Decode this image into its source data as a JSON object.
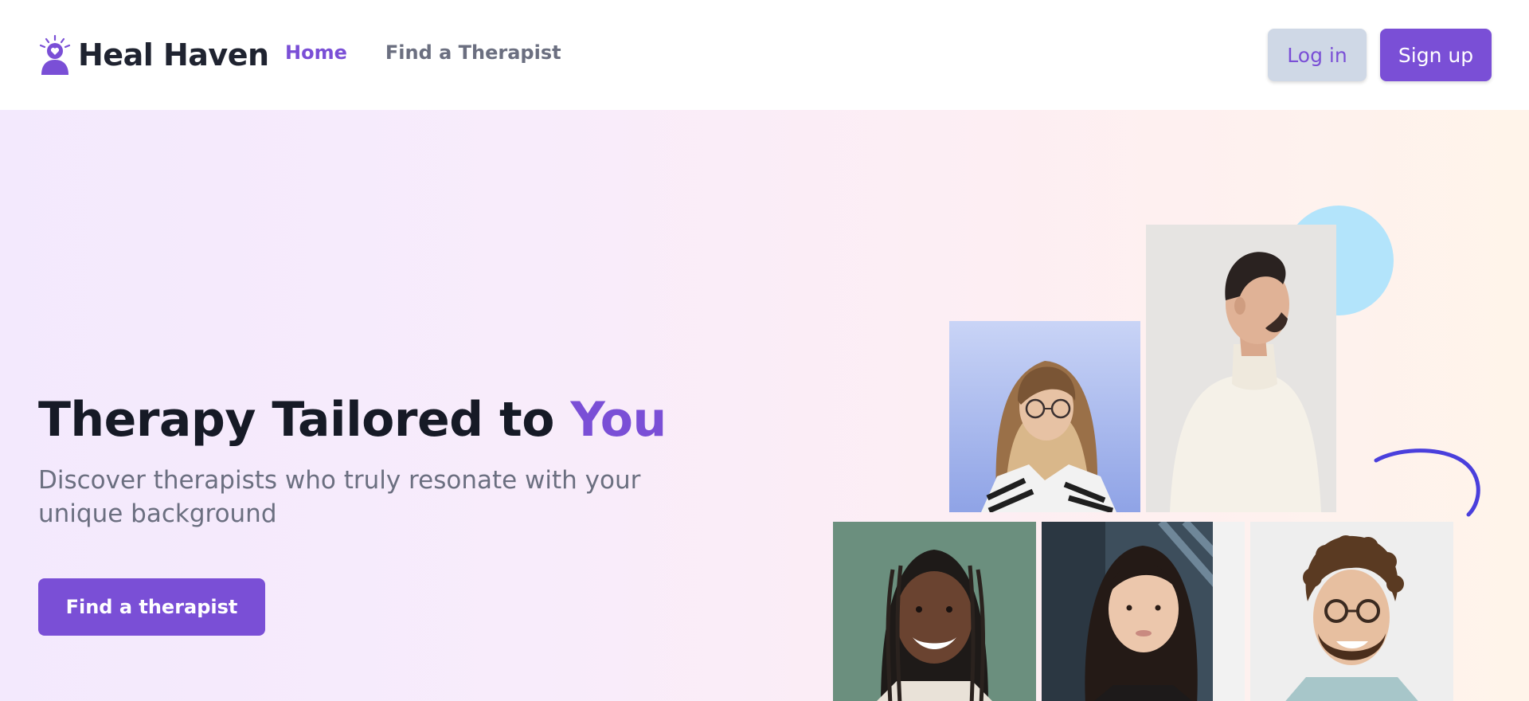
{
  "header": {
    "brand": "Heal Haven",
    "logo_icon": "person-heart-lightbulb-icon",
    "nav": [
      {
        "label": "Home",
        "active": true
      },
      {
        "label": "Find a Therapist",
        "active": false
      }
    ],
    "login_label": "Log in",
    "signup_label": "Sign up"
  },
  "hero": {
    "title_main": "Therapy Tailored to ",
    "title_accent": "You",
    "subtitle": "Discover therapists who truly resonate with your unique background",
    "cta_label": "Find a therapist"
  },
  "colors": {
    "accent": "#7a4fd6",
    "heading": "#161a26",
    "muted": "#6b6f80",
    "login_bg": "#cfd8e6",
    "circle": "#b3e4fb"
  },
  "photos": [
    {
      "subject": "woman-with-glasses-striped-shirt"
    },
    {
      "subject": "man-in-profile-white-sweater"
    },
    {
      "subject": "smiling-woman-with-braids"
    },
    {
      "subject": "woman-with-dark-hair"
    },
    {
      "subject": "smiling-man-with-curly-hair-glasses"
    }
  ]
}
